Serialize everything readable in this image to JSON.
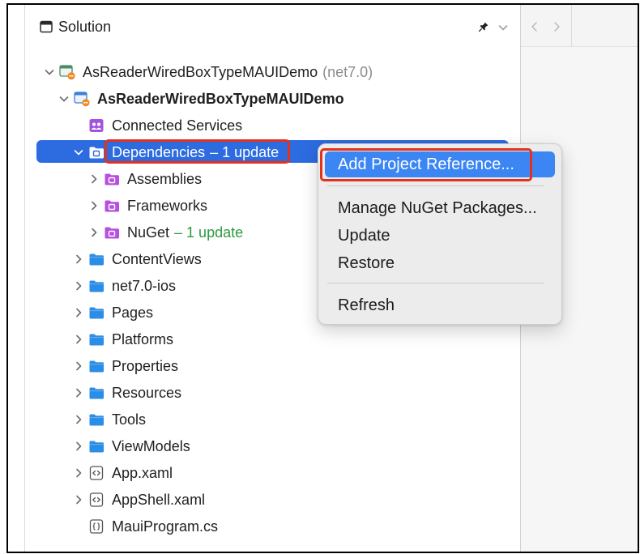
{
  "panel": {
    "title": "Solution",
    "title_icon": "sidebar-icon",
    "pin_icon": "pin-icon",
    "options_icon": "chevron-down-icon"
  },
  "navigation": {
    "back_icon": "back-arrow-icon",
    "forward_icon": "forward-arrow-icon",
    "enabled": false
  },
  "tree": {
    "rows": [
      {
        "label": "AsReaderWiredBoxTypeMAUIDemo",
        "suffix": "(net7.0)",
        "icon": "solution-icon",
        "expanded": true
      },
      {
        "label": "AsReaderWiredBoxTypeMAUIDemo",
        "icon": "project-icon",
        "expanded": true
      },
      {
        "label": "Connected Services",
        "icon": "connected-services-icon"
      },
      {
        "label": "Dependencies",
        "suffix": "– 1 update",
        "icon": "dependencies-icon",
        "expanded": true,
        "selected": true
      },
      {
        "label": "Assemblies",
        "icon": "package-folder-icon",
        "expanded": false
      },
      {
        "label": "Frameworks",
        "icon": "package-folder-icon",
        "expanded": false
      },
      {
        "label": "NuGet",
        "suffix": "– 1 update",
        "icon": "package-folder-icon",
        "expanded": false
      },
      {
        "label": "ContentViews",
        "icon": "folder-icon",
        "expanded": false
      },
      {
        "label": "net7.0-ios",
        "icon": "folder-icon",
        "expanded": false
      },
      {
        "label": "Pages",
        "icon": "folder-icon",
        "expanded": false
      },
      {
        "label": "Platforms",
        "icon": "folder-icon",
        "expanded": false
      },
      {
        "label": "Properties",
        "icon": "folder-icon",
        "expanded": false
      },
      {
        "label": "Resources",
        "icon": "folder-icon",
        "expanded": false
      },
      {
        "label": "Tools",
        "icon": "folder-icon",
        "expanded": false
      },
      {
        "label": "ViewModels",
        "icon": "folder-icon",
        "expanded": false
      },
      {
        "label": "App.xaml",
        "icon": "xaml-file-icon",
        "expanded": false
      },
      {
        "label": "AppShell.xaml",
        "icon": "xaml-file-icon",
        "expanded": false
      },
      {
        "label": "MauiProgram.cs",
        "icon": "cs-file-icon"
      }
    ]
  },
  "context_menu": {
    "items": [
      {
        "label": "Add Project Reference...",
        "highlighted": true
      },
      {
        "label": "Manage NuGet Packages..."
      },
      {
        "label": "Update"
      },
      {
        "label": "Restore"
      },
      {
        "label": "Refresh"
      }
    ]
  },
  "colors": {
    "selection": "#2d6be0",
    "menu_highlight": "#3c86f4",
    "annotation": "#e3311d",
    "update_badge_text": "#2c9a3e",
    "folder": "#2a8de6",
    "package_folder": "#b74fe0",
    "secondary_text": "#8c8c8c"
  }
}
